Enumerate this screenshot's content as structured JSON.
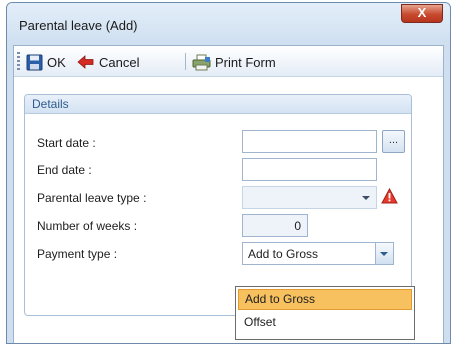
{
  "window": {
    "title": "Parental leave (Add)",
    "close_glyph": "X"
  },
  "toolbar": {
    "ok_label": "OK",
    "ok_icon": "save-disk-icon",
    "cancel_label": "Cancel",
    "cancel_icon": "red-back-arrow-icon",
    "print_label": "Print Form",
    "print_icon": "printer-icon"
  },
  "details": {
    "header": "Details",
    "start_date": {
      "label": "Start date :",
      "value": "",
      "button": "..."
    },
    "end_date": {
      "label": "End date :",
      "value": ""
    },
    "leave_type": {
      "label": "Parental leave type :",
      "value": "",
      "warning_icon": "warning-triangle-icon"
    },
    "weeks": {
      "label": "Number of weeks :",
      "value": "0"
    },
    "payment_type": {
      "label": "Payment type :",
      "value": "Add to Gross"
    }
  },
  "payment_dropdown": {
    "options": [
      "Add to Gross",
      "Offset"
    ],
    "selected": "Add to Gross"
  },
  "colors": {
    "accent_blue": "#2f5b8e",
    "selection": "#f7c15f",
    "close_button": "#c74a2f",
    "warning": "#d62a2a"
  }
}
